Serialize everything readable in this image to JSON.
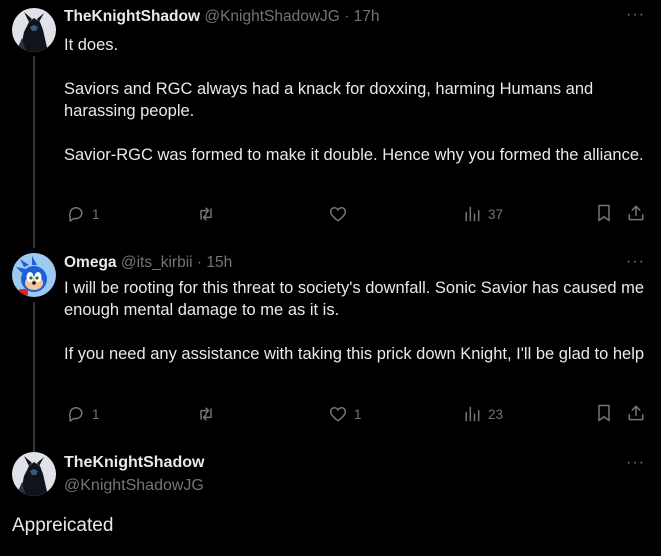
{
  "tweets": [
    {
      "name": "TheKnightShadow",
      "handle": "@KnightShadowJG",
      "dot": "·",
      "time": "17h",
      "more": "···",
      "text": "It does.\n\nSaviors and RGC always had a knack for doxxing, harming Humans and harassing people.\n\nSavior-RGC was formed to make it double. Hence why you formed the alliance.",
      "replies": "1",
      "reposts": "",
      "likes": "",
      "views": "37"
    },
    {
      "name": "Omega",
      "handle": "@its_kirbii",
      "dot": "·",
      "time": "15h",
      "more": "···",
      "text": "I will be rooting for this threat to society's downfall. Sonic Savior has caused me enough mental damage to me as it is.\n\nIf you need any assistance with taking this prick down Knight, I'll be glad to help",
      "replies": "1",
      "reposts": "",
      "likes": "1",
      "views": "23"
    }
  ],
  "focus": {
    "name": "TheKnightShadow",
    "handle": "@KnightShadowJG",
    "more": "···",
    "text": "Appreicated"
  },
  "icons": {
    "reply": "reply-icon",
    "repost": "repost-icon",
    "like": "like-icon",
    "views": "views-icon",
    "bookmark": "bookmark-icon",
    "share": "share-icon"
  },
  "colors": {
    "background": "#000000",
    "text": "#e7e9ea",
    "muted": "#71767b",
    "thread_line": "#333639"
  }
}
